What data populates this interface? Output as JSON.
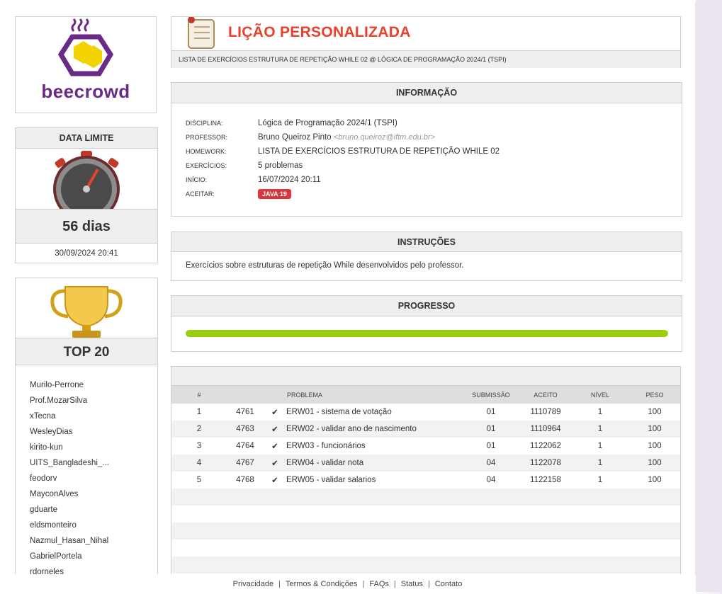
{
  "logo": {
    "text": "beecrowd"
  },
  "deadline": {
    "heading": "DATA LIMITE",
    "days_left": "56 dias",
    "date": "30/09/2024 20:41"
  },
  "top20": {
    "heading": "TOP 20",
    "users": [
      "Murilo-Perrone",
      "Prof.MozarSilva",
      "xTecna",
      "WesleyDias",
      "kirito-kun",
      "UITS_Bangladeshi_...",
      "feodorv",
      "MayconAlves",
      "gduarte",
      "eldsmonteiro",
      "Nazmul_Hasan_Nihal",
      "GabrielPortela",
      "rdorneles"
    ]
  },
  "header": {
    "title": "LIÇÃO PERSONALIZADA",
    "subtitle": "LISTA DE EXERCÍCIOS ESTRUTURA DE REPETIÇÃO WHILE 02 @ LÓGICA DE PROGRAMAÇÃO 2024/1 (TSPI)"
  },
  "info": {
    "heading": "INFORMAÇÃO",
    "labels": {
      "disciplina": "DISCIPLINA:",
      "professor": "PROFESSOR:",
      "homework": "HOMEWORK:",
      "exercicios": "EXERCÍCIOS:",
      "inicio": "INÍCIO:",
      "aceitar": "ACEITAR:"
    },
    "disciplina": "Lógica de Programação 2024/1 (TSPI)",
    "professor": "Bruno Queiroz Pinto",
    "professor_email": "<bruno.queiroz@iftm.edu.br>",
    "homework": "LISTA DE EXERCÍCIOS ESTRUTURA DE REPETIÇÃO WHILE 02",
    "exercicios": "5 problemas",
    "inicio": "16/07/2024 20:11",
    "aceitar": "JAVA 19"
  },
  "instructions": {
    "heading": "INSTRUÇÕES",
    "text": "Exercícios sobre estruturas de repetição While desenvolvidos pelo professor."
  },
  "progress": {
    "heading": "PROGRESSO",
    "percent": 100
  },
  "problems": {
    "columns": {
      "num": "#",
      "problema": "PROBLEMA",
      "submissao": "SUBMISSÃO",
      "aceito": "ACEITO",
      "nivel": "NÍVEL",
      "peso": "PESO"
    },
    "rows": [
      {
        "n": "1",
        "id": "4761",
        "name": "ERW01 - sistema de votação",
        "sub": "01",
        "acc": "1110789",
        "lvl": "1",
        "peso": "100"
      },
      {
        "n": "2",
        "id": "4763",
        "name": "ERW02 - validar ano de nascimento",
        "sub": "01",
        "acc": "1110964",
        "lvl": "1",
        "peso": "100"
      },
      {
        "n": "3",
        "id": "4764",
        "name": "ERW03 - funcionários",
        "sub": "01",
        "acc": "1122062",
        "lvl": "1",
        "peso": "100"
      },
      {
        "n": "4",
        "id": "4767",
        "name": "ERW04 - validar nota",
        "sub": "04",
        "acc": "1122078",
        "lvl": "1",
        "peso": "100"
      },
      {
        "n": "5",
        "id": "4768",
        "name": "ERW05 - validar salarios",
        "sub": "04",
        "acc": "1122158",
        "lvl": "1",
        "peso": "100"
      }
    ],
    "status_icon": "check-icon"
  },
  "footer": {
    "links": [
      "Privacidade",
      "Termos & Condições",
      "FAQs",
      "Status",
      "Contato"
    ]
  },
  "colors": {
    "accent_red": "#e8412c",
    "brand_purple": "#6a2b86",
    "progress_green": "#9acd0c",
    "check_green": "#4caf20"
  }
}
